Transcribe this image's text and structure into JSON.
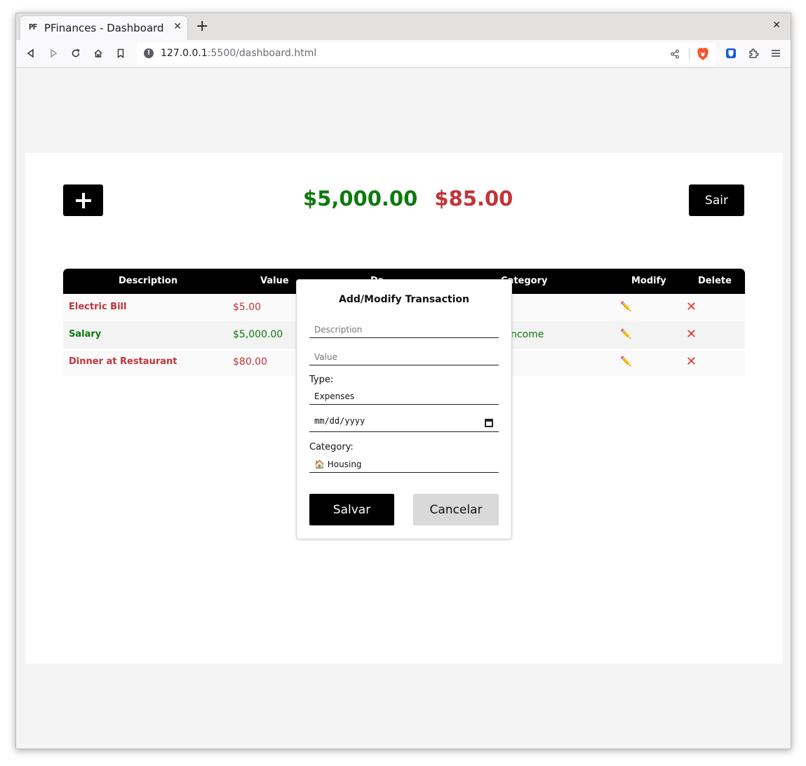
{
  "browser": {
    "tab_favicon": "PF",
    "tab_title": "PFinances - Dashboard",
    "tab_close": "✕",
    "new_tab": "+",
    "window_close": "✕",
    "url_host": "127.0.0.1",
    "url_rest": ":5500/dashboard.html"
  },
  "dashboard": {
    "add_label": "+",
    "income_total": "$5,000.00",
    "expense_total": "$85.00",
    "logout_label": "Sair"
  },
  "table": {
    "headers": [
      "Description",
      "Value",
      "Date",
      "Category",
      "Modify",
      "Delete"
    ],
    "visible_headers": {
      "description": "Description",
      "value": "Value",
      "date_partial": "Da",
      "category_partial": "Category",
      "modify": "Modify",
      "delete": "Delete"
    },
    "rows": [
      {
        "description": "Electric Bill",
        "value": "$5.00",
        "type": "expense",
        "category": ""
      },
      {
        "description": "Salary",
        "value": "$5,000.00",
        "type": "income",
        "category": "ncome"
      },
      {
        "description": "Dinner at Restaurant",
        "value": "$80.00",
        "type": "expense",
        "category": ""
      }
    ],
    "edit_icon": "pencil-icon",
    "delete_icon": "cross-icon"
  },
  "modal": {
    "title": "Add/Modify Transaction",
    "description_placeholder": "Description",
    "value_placeholder": "Value",
    "type_label": "Type:",
    "type_value": "Expenses",
    "date_placeholder": "mm/dd/yyyy",
    "category_label": "Category:",
    "category_value": "🏠 Housing",
    "save_label": "Salvar",
    "cancel_label": "Cancelar"
  },
  "colors": {
    "income": "#0c7a0c",
    "expense": "#c0353a",
    "primary_button": "#000000",
    "secondary_button": "#d9d9d9"
  }
}
